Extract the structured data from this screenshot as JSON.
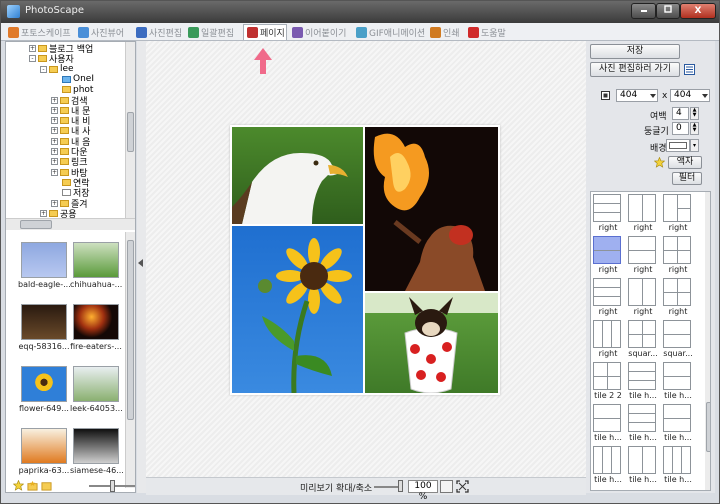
{
  "window": {
    "title": "PhotoScape",
    "close_glyph": "X"
  },
  "tabs": [
    {
      "label": "포토스케이프",
      "color": "#e07a2a"
    },
    {
      "label": "사진뷰어",
      "color": "#4a8fd8"
    },
    {
      "label": "사진편집",
      "color": "#3c6cc0"
    },
    {
      "label": "일괄편집",
      "color": "#3a9a5a"
    },
    {
      "label": "페이지",
      "color": "#c03030",
      "active": true
    },
    {
      "label": "이어붙이기",
      "color": "#7a5ab0"
    },
    {
      "label": "GIF애니메이션",
      "color": "#4aa0c8"
    },
    {
      "label": "인쇄",
      "color": "#d07a20"
    },
    {
      "label": "도움말",
      "color": "#d02a2a"
    }
  ],
  "tree": [
    {
      "label": "블로그 백업",
      "expander": "+",
      "indent": 1
    },
    {
      "label": "사용자",
      "expander": "-",
      "indent": 1
    },
    {
      "label": "lee",
      "expander": "-",
      "indent": 2
    },
    {
      "label": "OneI",
      "expander": "",
      "indent": 3
    },
    {
      "label": "phot",
      "expander": "",
      "indent": 3
    },
    {
      "label": "검색",
      "expander": "+",
      "indent": 3
    },
    {
      "label": "내 문",
      "expander": "+",
      "indent": 3
    },
    {
      "label": "내 비",
      "expander": "+",
      "indent": 3
    },
    {
      "label": "내 사",
      "expander": "+",
      "indent": 3
    },
    {
      "label": "내 음",
      "expander": "+",
      "indent": 3
    },
    {
      "label": "다운",
      "expander": "+",
      "indent": 3
    },
    {
      "label": "링크",
      "expander": "+",
      "indent": 3
    },
    {
      "label": "바탕",
      "expander": "+",
      "indent": 3
    },
    {
      "label": "연락",
      "expander": "",
      "indent": 3
    },
    {
      "label": "저장",
      "expander": "",
      "indent": 3
    },
    {
      "label": "즐겨",
      "expander": "+",
      "indent": 3
    },
    {
      "label": "공용",
      "expander": "+",
      "indent": 2
    }
  ],
  "thumbnails": [
    {
      "name": "bald-eagle-...",
      "kind": "eagle"
    },
    {
      "name": "chihuahua-...",
      "kind": "dog"
    },
    {
      "name": "eqq-58316...",
      "kind": "dark"
    },
    {
      "name": "fire-eaters-...",
      "kind": "fire"
    },
    {
      "name": "flower-649...",
      "kind": "flower"
    },
    {
      "name": "leek-64053...",
      "kind": "leek"
    },
    {
      "name": "paprika-63...",
      "kind": "paprika"
    },
    {
      "name": "siamese-46...",
      "kind": "cat"
    }
  ],
  "bottom_bar": {
    "preview_label": "미리보기 확대/축소",
    "zoom": "100 %"
  },
  "right": {
    "save_button": "저장",
    "edit_button": "사진 편집하러 가기",
    "width": "404",
    "x_label": "x",
    "height": "404",
    "margin_label": "여백",
    "margin_value": "4",
    "round_label": "둥글기",
    "round_value": "0",
    "bg_label": "배경",
    "frame_button": "액자",
    "filter_button": "필터"
  },
  "layouts": [
    {
      "name": "right",
      "split": "h3"
    },
    {
      "name": "right",
      "split": "v2"
    },
    {
      "name": "right",
      "split": "v2b"
    },
    {
      "name": "right",
      "split": "sel"
    },
    {
      "name": "right",
      "split": "h2"
    },
    {
      "name": "right",
      "split": "g4"
    },
    {
      "name": "right",
      "split": "h3"
    },
    {
      "name": "right",
      "split": "v2"
    },
    {
      "name": "right",
      "split": "g4"
    },
    {
      "name": "right",
      "split": "v3"
    },
    {
      "name": "squar...",
      "split": "g4"
    },
    {
      "name": "squar...",
      "split": "h2"
    },
    {
      "name": "tile 2 2",
      "split": "g4"
    },
    {
      "name": "tile h...",
      "split": "h3"
    },
    {
      "name": "tile h...",
      "split": "h2"
    },
    {
      "name": "tile h...",
      "split": "h2"
    },
    {
      "name": "tile h...",
      "split": "h3"
    },
    {
      "name": "tile h...",
      "split": "h2"
    },
    {
      "name": "tile h...",
      "split": "v3"
    },
    {
      "name": "tile h...",
      "split": "v2"
    },
    {
      "name": "tile h...",
      "split": "v3"
    }
  ],
  "colors": {
    "accent_arrow": "#f06a8a",
    "selection": "#9fb0f0"
  }
}
